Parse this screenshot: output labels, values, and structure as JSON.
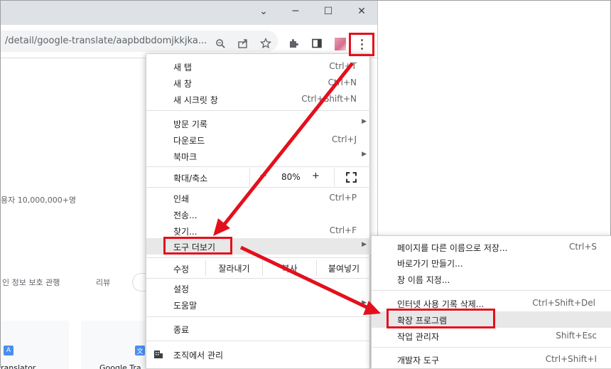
{
  "window": {
    "minimize": "─",
    "maximize": "☐",
    "close": "✕",
    "dropdown": "⌄"
  },
  "omnibox": {
    "url": "/detail/google-translate/aapbdbdomjkkjka..."
  },
  "page": {
    "users": "용자 10,000,000+명",
    "tab_privacy": "인 정보 보호 관행",
    "tab_reviews": "리뷰",
    "card1_title": "ranslator",
    "card2_title": "Google Tra"
  },
  "menu": {
    "new_tab": {
      "label": "새 탭",
      "shortcut": "Ctrl+T"
    },
    "new_window": {
      "label": "새 창",
      "shortcut": "Ctrl+N"
    },
    "incognito": {
      "label": "새 시크릿 창",
      "shortcut": "Ctrl+Shift+N"
    },
    "history": {
      "label": "방문 기록"
    },
    "downloads": {
      "label": "다운로드",
      "shortcut": "Ctrl+J"
    },
    "bookmarks": {
      "label": "북마크"
    },
    "zoom": {
      "label": "확대/축소",
      "minus": "−",
      "value": "80%",
      "plus": "+",
      "fullscreen": "⛶"
    },
    "print": {
      "label": "인쇄",
      "shortcut": "Ctrl+P"
    },
    "cast": {
      "label": "전송..."
    },
    "find": {
      "label": "찾기...",
      "shortcut": "Ctrl+F"
    },
    "more_tools": {
      "label": "도구 더보기"
    },
    "edit": {
      "label": "수정",
      "cut": "잘라내기",
      "copy": "복사",
      "paste": "붙여넣기"
    },
    "settings": {
      "label": "설정"
    },
    "help": {
      "label": "도움말"
    },
    "exit": {
      "label": "종료"
    },
    "managed": {
      "label": "조직에서 관리"
    }
  },
  "submenu": {
    "save_as": {
      "label": "페이지를 다른 이름으로 저장...",
      "shortcut": "Ctrl+S"
    },
    "shortcut": {
      "label": "바로가기 만들기..."
    },
    "name_window": {
      "label": "창 이름 지정..."
    },
    "clear_data": {
      "label": "인터넷 사용 기록 삭제...",
      "shortcut": "Ctrl+Shift+Del"
    },
    "extensions": {
      "label": "확장 프로그램"
    },
    "task_manager": {
      "label": "작업 관리자",
      "shortcut": "Shift+Esc"
    },
    "devtools": {
      "label": "개발자 도구",
      "shortcut": "Ctrl+Shift+I"
    }
  },
  "colors": {
    "annotation": "#e3101c",
    "highlight": "#e8e8e8"
  }
}
